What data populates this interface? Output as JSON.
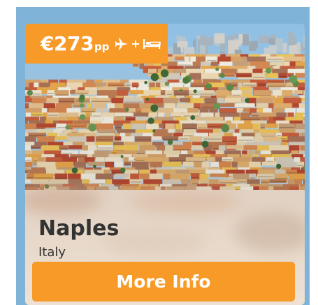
{
  "card": {
    "price": {
      "amount": "€273",
      "unit": "pp",
      "separator": "+",
      "icons": [
        "plane-icon",
        "bed-icon"
      ]
    },
    "city": "Naples",
    "country": "Italy",
    "button_label": "More Info"
  },
  "colors": {
    "accent": "#f79a28",
    "sky": "#7fb4d8",
    "text": "#333333",
    "panel": "#e6d6c7"
  }
}
